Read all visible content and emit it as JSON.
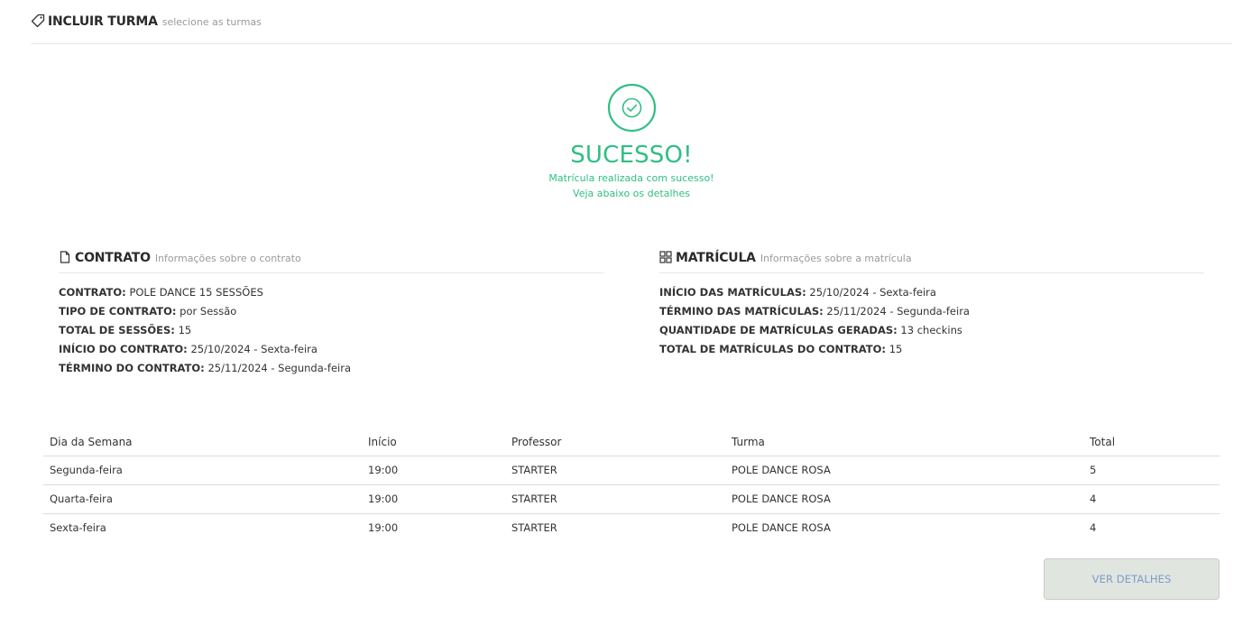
{
  "header": {
    "title": "INCLUIR TURMA",
    "subtitle": "selecione as turmas"
  },
  "success": {
    "heading": "SUCESSO!",
    "line1": "Matrícula realizada com sucesso!",
    "line2": "Veja abaixo os detalhes",
    "color": "#2fbf84"
  },
  "contrato": {
    "title": "CONTRATO",
    "subtitle": "Informações sobre o contrato",
    "rows": [
      {
        "label": "CONTRATO:",
        "value": "POLE DANCE 15 SESSÕES"
      },
      {
        "label": "TIPO DE CONTRATO:",
        "value": "por Sessão"
      },
      {
        "label": "TOTAL DE SESSÕES:",
        "value": "15"
      },
      {
        "label": "INÍCIO DO CONTRATO:",
        "value": "25/10/2024 - Sexta-feira"
      },
      {
        "label": "TÉRMINO DO CONTRATO:",
        "value": "25/11/2024 - Segunda-feira"
      }
    ]
  },
  "matricula": {
    "title": "MATRÍCULA",
    "subtitle": "Informações sobre a matrícula",
    "rows": [
      {
        "label": "INÍCIO DAS MATRÍCULAS:",
        "value": "25/10/2024 - Sexta-feira"
      },
      {
        "label": "TÉRMINO DAS MATRÍCULAS:",
        "value": "25/11/2024 - Segunda-feira"
      },
      {
        "label": "QUANTIDADE DE MATRÍCULAS GERADAS:",
        "value": "13 checkins"
      },
      {
        "label": "TOTAL DE MATRÍCULAS DO CONTRATO:",
        "value": "15"
      }
    ]
  },
  "table": {
    "headers": [
      "Dia da Semana",
      "Início",
      "Professor",
      "Turma",
      "Total"
    ],
    "rows": [
      [
        "Segunda-feira",
        "19:00",
        "STARTER",
        "POLE DANCE ROSA",
        "5"
      ],
      [
        "Quarta-feira",
        "19:00",
        "STARTER",
        "POLE DANCE ROSA",
        "4"
      ],
      [
        "Sexta-feira",
        "19:00",
        "STARTER",
        "POLE DANCE ROSA",
        "4"
      ]
    ]
  },
  "button": {
    "label": "VER DETALHES"
  }
}
